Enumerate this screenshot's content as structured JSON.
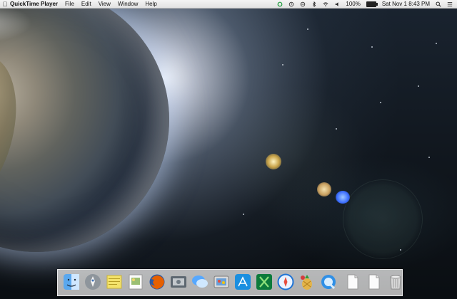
{
  "menubar": {
    "apple_icon": "apple-logo-icon",
    "app_name": "QuickTime Player",
    "menus": [
      "File",
      "Edit",
      "View",
      "Window",
      "Help"
    ],
    "status": {
      "battery_percent": "100%",
      "datetime": "Sat Nov 1  8:43 PM"
    }
  },
  "dock": {
    "items": [
      {
        "name": "finder",
        "icon": "finder-icon"
      },
      {
        "name": "launchpad",
        "icon": "rocket-icon"
      },
      {
        "name": "stickies",
        "icon": "stickies-icon"
      },
      {
        "name": "preview",
        "icon": "preview-icon"
      },
      {
        "name": "firefox",
        "icon": "firefox-icon"
      },
      {
        "name": "dvd-player",
        "icon": "dvd-player-icon"
      },
      {
        "name": "messages",
        "icon": "messages-icon"
      },
      {
        "name": "photo-booth",
        "icon": "photo-icon"
      },
      {
        "name": "app-store",
        "icon": "app-store-icon"
      },
      {
        "name": "excel",
        "icon": "excel-icon"
      },
      {
        "name": "safari",
        "icon": "safari-icon"
      },
      {
        "name": "fruit-app",
        "icon": "pineapple-icon"
      },
      {
        "name": "quicktime",
        "icon": "quicktime-icon"
      },
      {
        "name": "document-1",
        "icon": "document-icon"
      },
      {
        "name": "document-2",
        "icon": "document-icon"
      },
      {
        "name": "trash",
        "icon": "trash-icon"
      }
    ]
  }
}
